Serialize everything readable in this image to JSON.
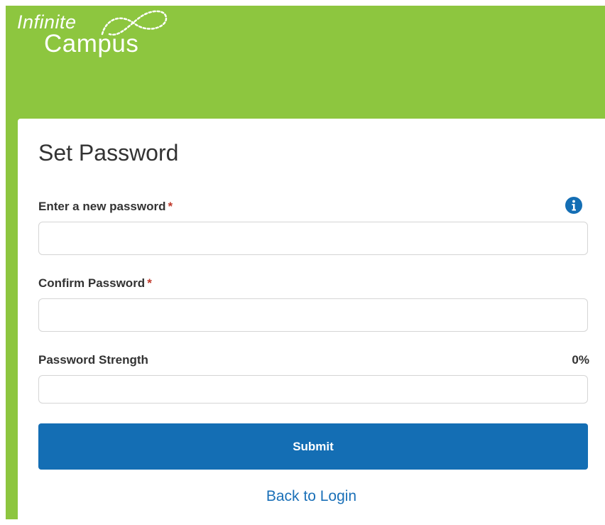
{
  "brand": {
    "line1": "Infinite",
    "line2": "Campus",
    "color": "#8dc63f"
  },
  "form": {
    "title": "Set Password",
    "new_password": {
      "label": "Enter a new password",
      "required_mark": "*",
      "value": "",
      "info_icon": "info-circle-icon"
    },
    "confirm_password": {
      "label": "Confirm Password",
      "required_mark": "*",
      "value": ""
    },
    "strength": {
      "label": "Password Strength",
      "value_text": "0%",
      "fraction": 0
    },
    "submit_label": "Submit",
    "back_link_label": "Back to Login"
  },
  "colors": {
    "accent": "#146eb4",
    "link": "#1a70b8",
    "required": "#c0392b"
  }
}
